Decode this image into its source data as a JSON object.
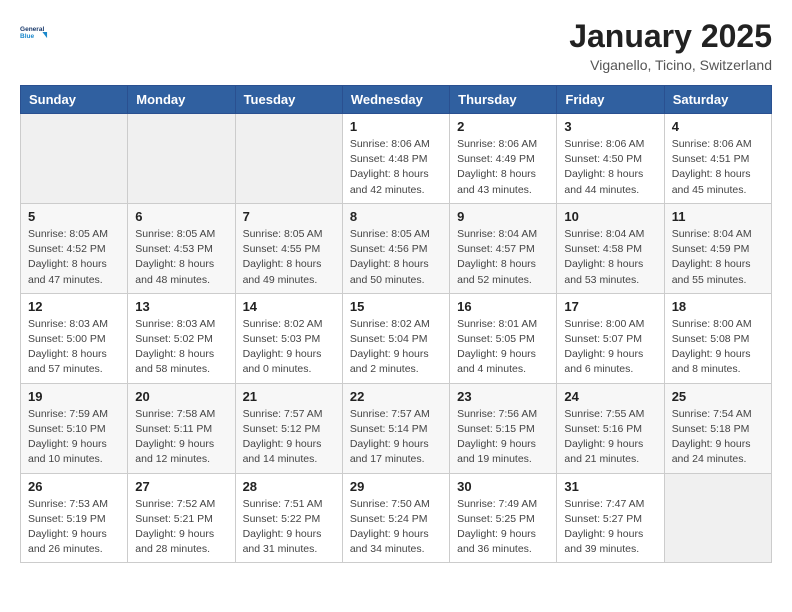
{
  "header": {
    "logo_line1": "General",
    "logo_line2": "Blue",
    "title": "January 2025",
    "subtitle": "Viganello, Ticino, Switzerland"
  },
  "weekdays": [
    "Sunday",
    "Monday",
    "Tuesday",
    "Wednesday",
    "Thursday",
    "Friday",
    "Saturday"
  ],
  "weeks": [
    [
      {
        "day": "",
        "info": ""
      },
      {
        "day": "",
        "info": ""
      },
      {
        "day": "",
        "info": ""
      },
      {
        "day": "1",
        "info": "Sunrise: 8:06 AM\nSunset: 4:48 PM\nDaylight: 8 hours and 42 minutes."
      },
      {
        "day": "2",
        "info": "Sunrise: 8:06 AM\nSunset: 4:49 PM\nDaylight: 8 hours and 43 minutes."
      },
      {
        "day": "3",
        "info": "Sunrise: 8:06 AM\nSunset: 4:50 PM\nDaylight: 8 hours and 44 minutes."
      },
      {
        "day": "4",
        "info": "Sunrise: 8:06 AM\nSunset: 4:51 PM\nDaylight: 8 hours and 45 minutes."
      }
    ],
    [
      {
        "day": "5",
        "info": "Sunrise: 8:05 AM\nSunset: 4:52 PM\nDaylight: 8 hours and 47 minutes."
      },
      {
        "day": "6",
        "info": "Sunrise: 8:05 AM\nSunset: 4:53 PM\nDaylight: 8 hours and 48 minutes."
      },
      {
        "day": "7",
        "info": "Sunrise: 8:05 AM\nSunset: 4:55 PM\nDaylight: 8 hours and 49 minutes."
      },
      {
        "day": "8",
        "info": "Sunrise: 8:05 AM\nSunset: 4:56 PM\nDaylight: 8 hours and 50 minutes."
      },
      {
        "day": "9",
        "info": "Sunrise: 8:04 AM\nSunset: 4:57 PM\nDaylight: 8 hours and 52 minutes."
      },
      {
        "day": "10",
        "info": "Sunrise: 8:04 AM\nSunset: 4:58 PM\nDaylight: 8 hours and 53 minutes."
      },
      {
        "day": "11",
        "info": "Sunrise: 8:04 AM\nSunset: 4:59 PM\nDaylight: 8 hours and 55 minutes."
      }
    ],
    [
      {
        "day": "12",
        "info": "Sunrise: 8:03 AM\nSunset: 5:00 PM\nDaylight: 8 hours and 57 minutes."
      },
      {
        "day": "13",
        "info": "Sunrise: 8:03 AM\nSunset: 5:02 PM\nDaylight: 8 hours and 58 minutes."
      },
      {
        "day": "14",
        "info": "Sunrise: 8:02 AM\nSunset: 5:03 PM\nDaylight: 9 hours and 0 minutes."
      },
      {
        "day": "15",
        "info": "Sunrise: 8:02 AM\nSunset: 5:04 PM\nDaylight: 9 hours and 2 minutes."
      },
      {
        "day": "16",
        "info": "Sunrise: 8:01 AM\nSunset: 5:05 PM\nDaylight: 9 hours and 4 minutes."
      },
      {
        "day": "17",
        "info": "Sunrise: 8:00 AM\nSunset: 5:07 PM\nDaylight: 9 hours and 6 minutes."
      },
      {
        "day": "18",
        "info": "Sunrise: 8:00 AM\nSunset: 5:08 PM\nDaylight: 9 hours and 8 minutes."
      }
    ],
    [
      {
        "day": "19",
        "info": "Sunrise: 7:59 AM\nSunset: 5:10 PM\nDaylight: 9 hours and 10 minutes."
      },
      {
        "day": "20",
        "info": "Sunrise: 7:58 AM\nSunset: 5:11 PM\nDaylight: 9 hours and 12 minutes."
      },
      {
        "day": "21",
        "info": "Sunrise: 7:57 AM\nSunset: 5:12 PM\nDaylight: 9 hours and 14 minutes."
      },
      {
        "day": "22",
        "info": "Sunrise: 7:57 AM\nSunset: 5:14 PM\nDaylight: 9 hours and 17 minutes."
      },
      {
        "day": "23",
        "info": "Sunrise: 7:56 AM\nSunset: 5:15 PM\nDaylight: 9 hours and 19 minutes."
      },
      {
        "day": "24",
        "info": "Sunrise: 7:55 AM\nSunset: 5:16 PM\nDaylight: 9 hours and 21 minutes."
      },
      {
        "day": "25",
        "info": "Sunrise: 7:54 AM\nSunset: 5:18 PM\nDaylight: 9 hours and 24 minutes."
      }
    ],
    [
      {
        "day": "26",
        "info": "Sunrise: 7:53 AM\nSunset: 5:19 PM\nDaylight: 9 hours and 26 minutes."
      },
      {
        "day": "27",
        "info": "Sunrise: 7:52 AM\nSunset: 5:21 PM\nDaylight: 9 hours and 28 minutes."
      },
      {
        "day": "28",
        "info": "Sunrise: 7:51 AM\nSunset: 5:22 PM\nDaylight: 9 hours and 31 minutes."
      },
      {
        "day": "29",
        "info": "Sunrise: 7:50 AM\nSunset: 5:24 PM\nDaylight: 9 hours and 34 minutes."
      },
      {
        "day": "30",
        "info": "Sunrise: 7:49 AM\nSunset: 5:25 PM\nDaylight: 9 hours and 36 minutes."
      },
      {
        "day": "31",
        "info": "Sunrise: 7:47 AM\nSunset: 5:27 PM\nDaylight: 9 hours and 39 minutes."
      },
      {
        "day": "",
        "info": ""
      }
    ]
  ]
}
